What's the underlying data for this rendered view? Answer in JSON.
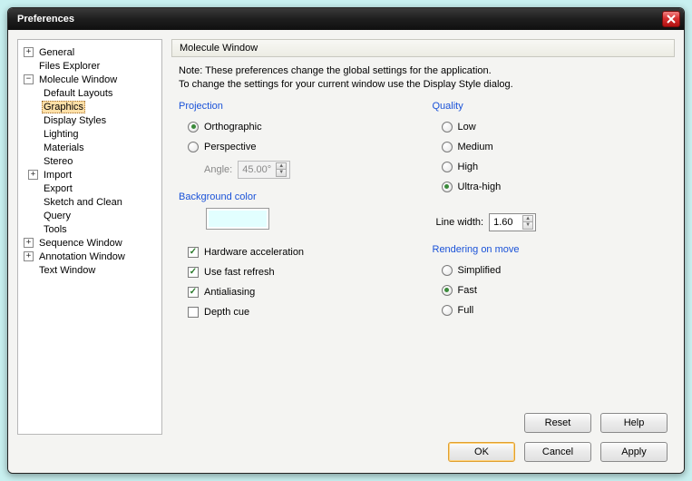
{
  "window": {
    "title": "Preferences"
  },
  "tree": {
    "general": "General",
    "files_explorer": "Files Explorer",
    "molecule_window": "Molecule Window",
    "mw_children": {
      "default_layouts": "Default Layouts",
      "graphics": "Graphics",
      "display_styles": "Display Styles",
      "lighting": "Lighting",
      "materials": "Materials",
      "stereo": "Stereo",
      "import": "Import",
      "export": "Export",
      "sketch_and_clean": "Sketch and Clean",
      "query": "Query",
      "tools": "Tools"
    },
    "sequence_window": "Sequence Window",
    "annotation_window": "Annotation Window",
    "text_window": "Text Window"
  },
  "panel": {
    "title": "Molecule Window",
    "note1": "Note: These preferences change the global settings for the application.",
    "note2": "To change the settings for your current window use the Display Style dialog."
  },
  "projection": {
    "title": "Projection",
    "orthographic": "Orthographic",
    "perspective": "Perspective",
    "angle_label": "Angle:",
    "angle_value": "45.00°"
  },
  "background": {
    "title": "Background color",
    "swatch_color": "#e2ffff"
  },
  "checks": {
    "hw_accel": "Hardware acceleration",
    "fast_refresh": "Use fast refresh",
    "antialias": "Antialiasing",
    "depth_cue": "Depth cue"
  },
  "quality": {
    "title": "Quality",
    "low": "Low",
    "medium": "Medium",
    "high": "High",
    "ultra": "Ultra-high"
  },
  "linewidth": {
    "label": "Line width:",
    "value": "1.60"
  },
  "render_move": {
    "title": "Rendering on move",
    "simplified": "Simplified",
    "fast": "Fast",
    "full": "Full"
  },
  "buttons": {
    "reset": "Reset",
    "help": "Help",
    "ok": "OK",
    "cancel": "Cancel",
    "apply": "Apply"
  }
}
